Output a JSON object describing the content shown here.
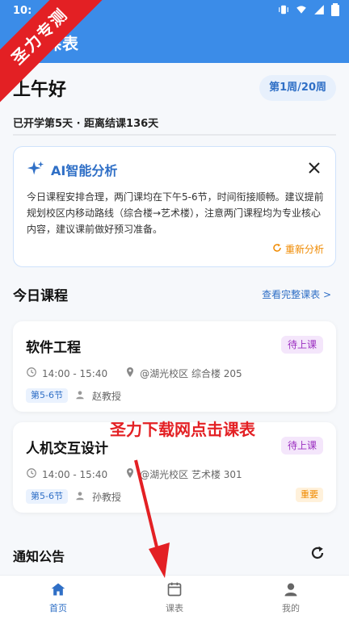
{
  "statusBar": {
    "time": "10:",
    "icons": [
      "vibrate-icon",
      "wifi-icon",
      "signal-icon",
      "battery-icon"
    ]
  },
  "appBar": {
    "title": "课表"
  },
  "watermark": {
    "cornerLabel": "圣力专测",
    "overlayCaption": "圣力下载网点击课表"
  },
  "dashboard": {
    "greeting": "上午好",
    "weekBadge": "第1周/20周",
    "termProgress": "已开学第5天 · 距离结课136天"
  },
  "aiAnalysis": {
    "title": "AI智能分析",
    "text": "今日课程安排合理，两门课均在下午5-6节，时间衔接顺畅。建议提前规划校区内移动路线（综合楼→艺术楼），注意两门课程均为专业核心内容，建议课前做好预习准备。",
    "refresh": "重新分析",
    "icons": [
      "sparkle-icon",
      "close-icon",
      "refresh-icon"
    ]
  },
  "today": {
    "title": "今日课程",
    "viewAll": "查看完整课表 >"
  },
  "courses": [
    {
      "name": "软件工程",
      "status": "待上课",
      "time": "14:00 - 15:40",
      "location": "@湖光校区 综合楼 205",
      "slot": "第5-6节",
      "teacher": "赵教授",
      "tag": ""
    },
    {
      "name": "人机交互设计",
      "status": "待上课",
      "time": "14:00 - 15:40",
      "location": "@湖光校区 艺术楼 301",
      "slot": "第5-6节",
      "teacher": "孙教授",
      "tag": "重要"
    }
  ],
  "notices": {
    "title": "通知公告"
  },
  "bottomNav": {
    "items": [
      {
        "label": "首页",
        "icon": "home-icon",
        "active": true
      },
      {
        "label": "课表",
        "icon": "calendar-icon",
        "active": false
      },
      {
        "label": "我的",
        "icon": "profile-icon",
        "active": false
      }
    ]
  },
  "colors": {
    "primary": "#3b8ce8",
    "accentBlue": "#2f6fc6",
    "accentOrange": "#f08a00",
    "statusPurple": "#9b2fc0",
    "watermarkRed": "#e32024"
  }
}
